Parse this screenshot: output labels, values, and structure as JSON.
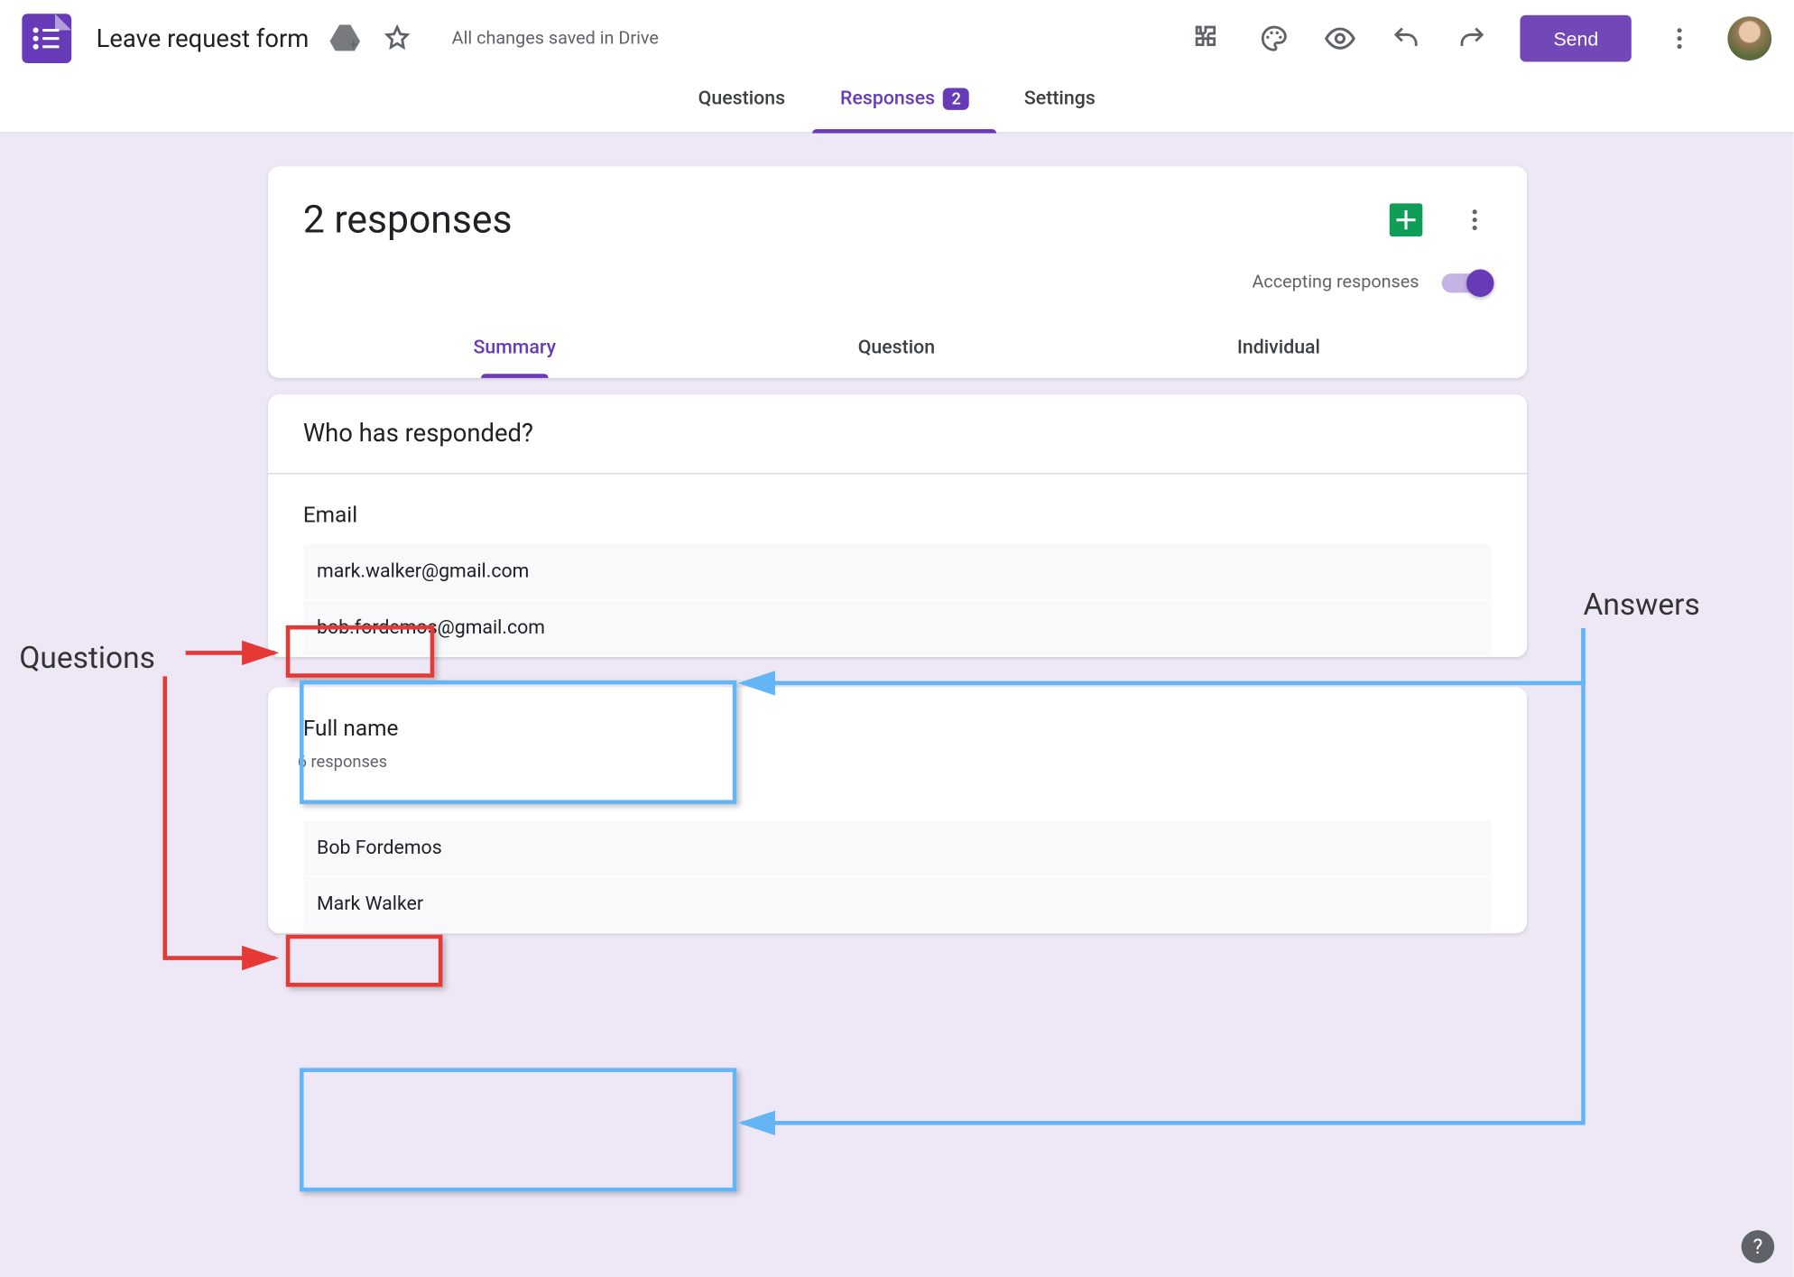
{
  "header": {
    "title": "Leave request form",
    "saved_text": "All changes saved in Drive",
    "send_label": "Send"
  },
  "tabs": {
    "questions": "Questions",
    "responses": "Responses",
    "responses_count": "2",
    "settings": "Settings",
    "active": "responses"
  },
  "responses_header": {
    "title": "2 responses",
    "accepting_label": "Accepting responses",
    "accepting_on": true
  },
  "subtabs": {
    "summary": "Summary",
    "question": "Question",
    "individual": "Individual",
    "active": "summary"
  },
  "card_who": {
    "title": "Who has responded?",
    "question_label": "Email",
    "answers": [
      "mark.walker@gmail.com",
      "bob.fordemos@gmail.com"
    ]
  },
  "card_fullname": {
    "question_label": "Full name",
    "response_count": "6 responses",
    "answers": [
      "Bob Fordemos",
      "Mark Walker"
    ]
  },
  "annotations": {
    "questions_label": "Questions",
    "answers_label": "Answers"
  }
}
